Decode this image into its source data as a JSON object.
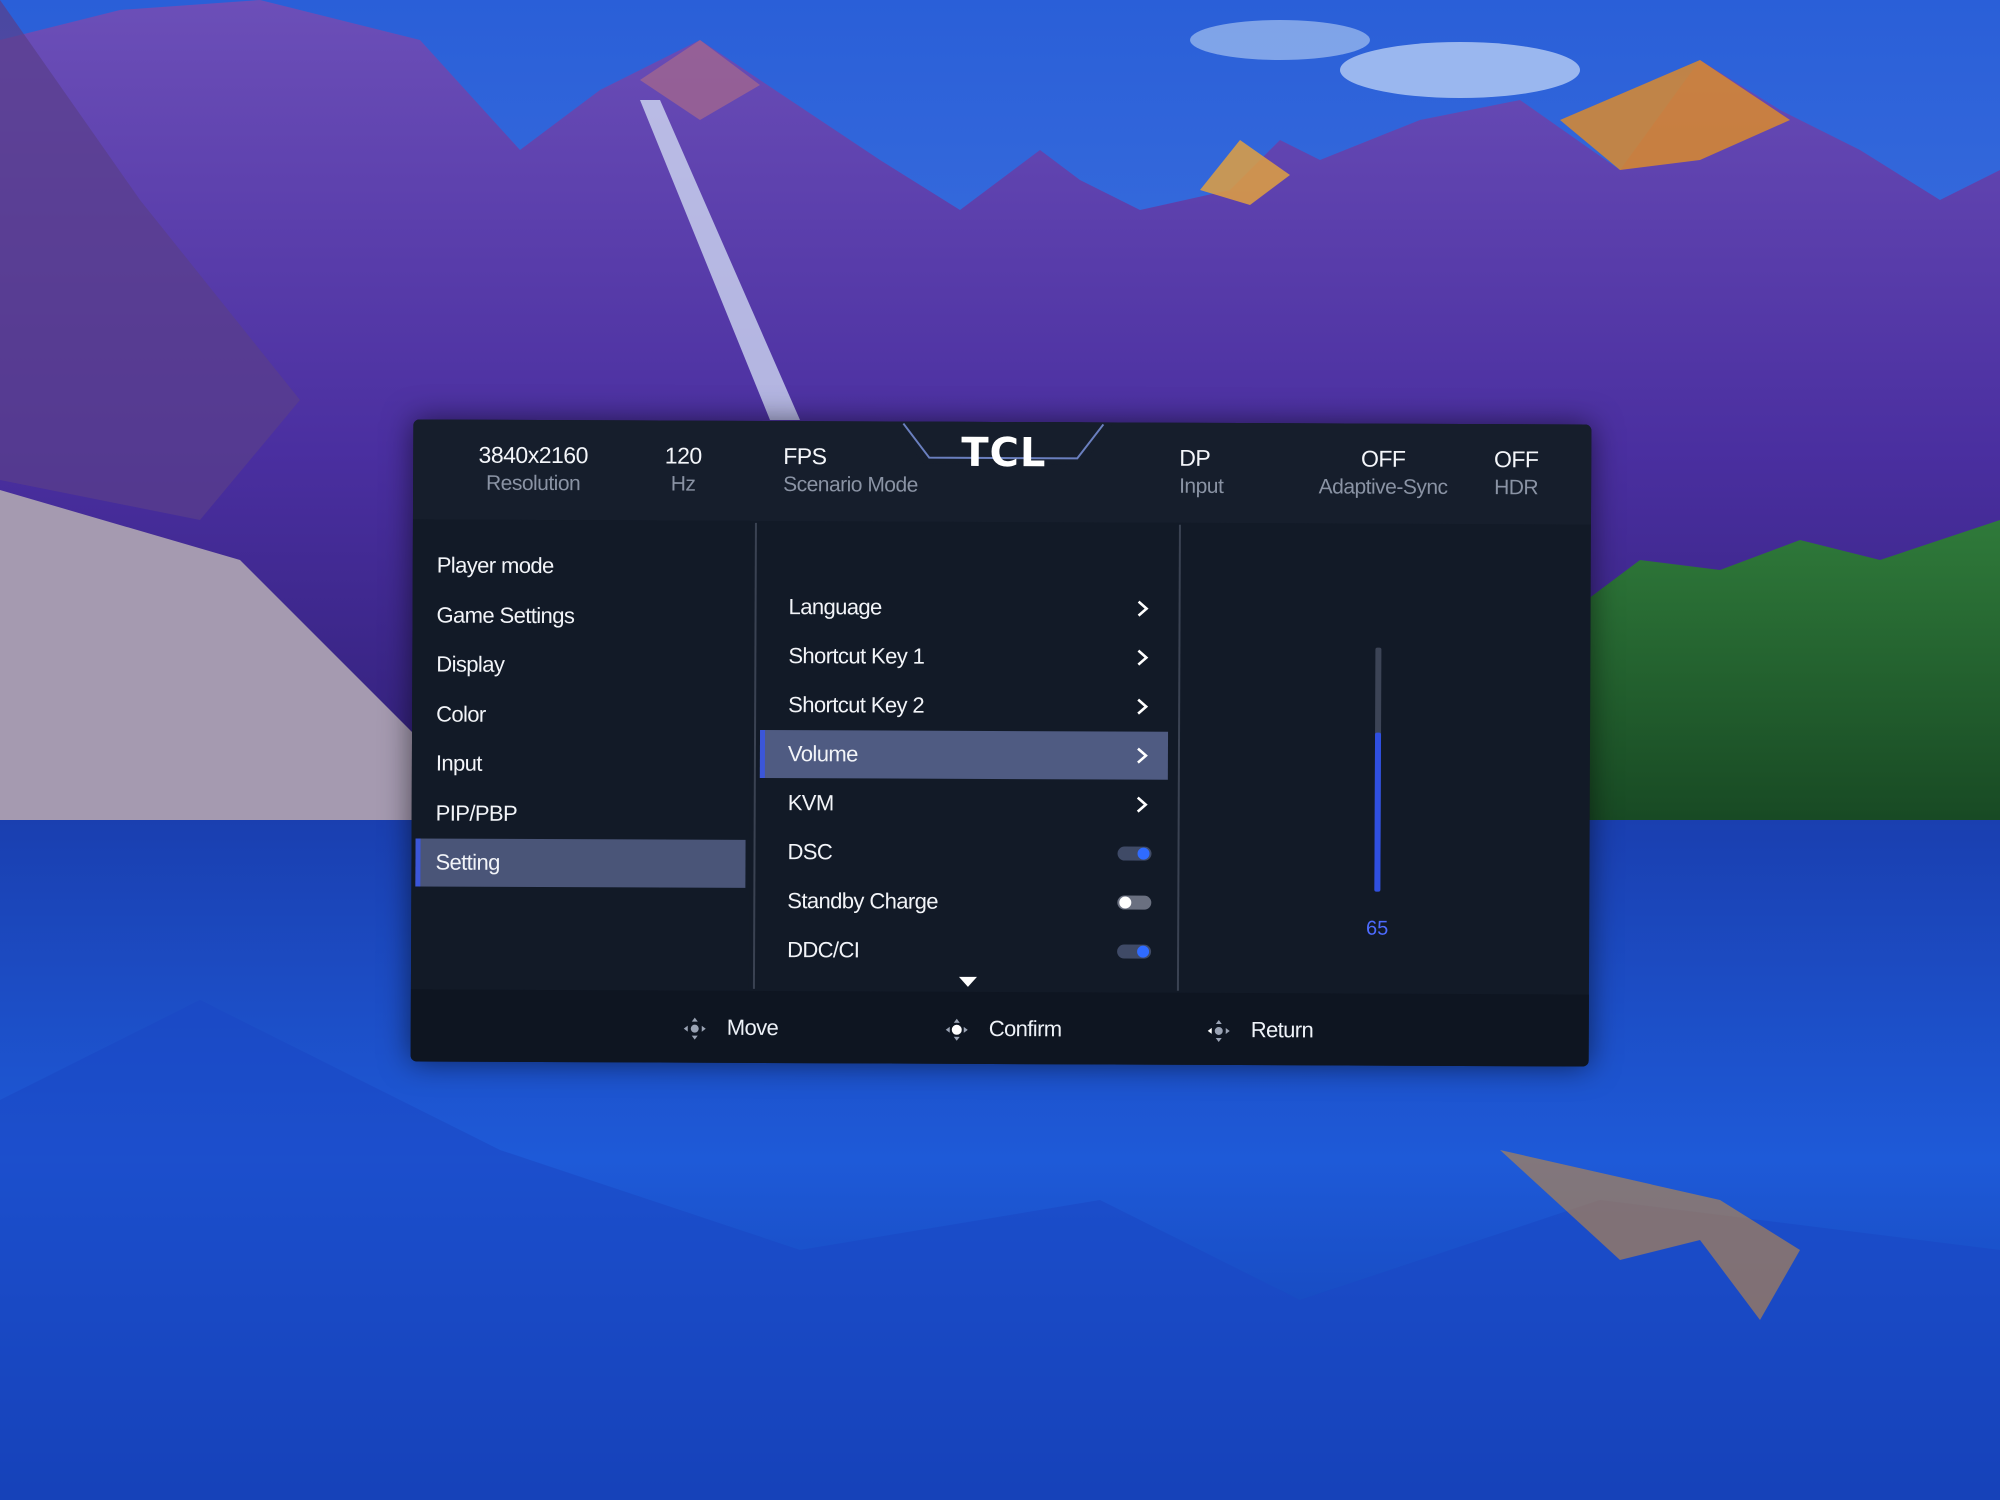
{
  "brand": "TCL",
  "status_bar": [
    {
      "value": "3840x2160",
      "label": "Resolution"
    },
    {
      "value": "120",
      "label": "Hz"
    },
    {
      "value": "FPS",
      "label": "Scenario Mode"
    },
    {
      "value": "DP",
      "label": "Input"
    },
    {
      "value": "OFF",
      "label": "Adaptive-Sync"
    },
    {
      "value": "OFF",
      "label": "HDR"
    }
  ],
  "menu": {
    "items": [
      "Player mode",
      "Game Settings",
      "Display",
      "Color",
      "Input",
      "PIP/PBP",
      "Setting"
    ],
    "selected": "Setting"
  },
  "submenu": {
    "items": [
      {
        "label": "Language",
        "control": "arrow"
      },
      {
        "label": "Shortcut Key 1",
        "control": "arrow"
      },
      {
        "label": "Shortcut Key 2",
        "control": "arrow"
      },
      {
        "label": "Volume",
        "control": "arrow"
      },
      {
        "label": "KVM",
        "control": "arrow"
      },
      {
        "label": "DSC",
        "control": "toggle",
        "state": "on"
      },
      {
        "label": "Standby Charge",
        "control": "toggle",
        "state": "off"
      },
      {
        "label": "DDC/CI",
        "control": "toggle",
        "state": "on"
      }
    ],
    "selected": "Volume",
    "more_indicator": "down-triangle-icon"
  },
  "volume": {
    "value": "65",
    "fraction": 0.65
  },
  "footer_hints": [
    {
      "icon": "dpad-move-icon",
      "label": "Move"
    },
    {
      "icon": "dpad-confirm-icon",
      "label": "Confirm"
    },
    {
      "icon": "dpad-return-icon",
      "label": "Return"
    }
  ],
  "colors": {
    "panel": "#121a27",
    "highlight": "#4f5b82",
    "accent_blue": "#2f4fe0",
    "value_blue": "#4d6bff"
  }
}
